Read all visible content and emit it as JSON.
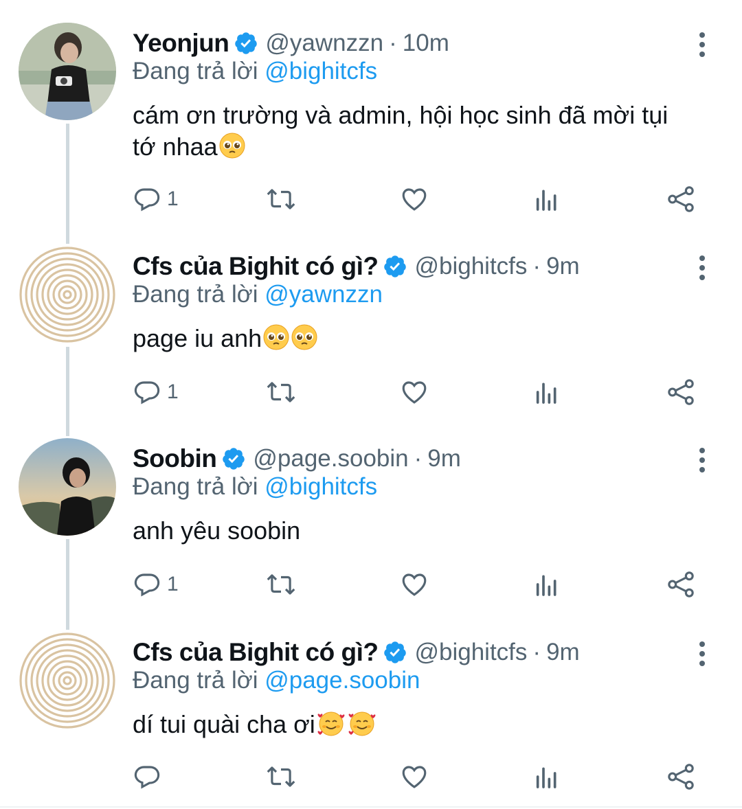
{
  "replying_prefix": "Đang trả lời",
  "colors": {
    "accent": "#1d9bf0",
    "muted": "#536471",
    "text": "#0f1419",
    "thread_line": "#cfd9de"
  },
  "tweets": [
    {
      "name": "Yeonjun",
      "handle": "@yawnzzn",
      "sep": "·",
      "time": "10m",
      "replying_to": "@bighitcfs",
      "text_lines": [
        "cám ơn trường và admin, hội học sinh đã mời tụi",
        "tớ nhaa"
      ],
      "emojis": [
        "pleading-face"
      ],
      "reply_count": "1",
      "avatar": "photo-person-with-camera"
    },
    {
      "name": "Cfs của Bighit có gì?",
      "handle": "@bighitcfs",
      "sep": "·",
      "time": "9m",
      "replying_to": "@yawnzzn",
      "text_lines": [
        "page iu anh"
      ],
      "emojis": [
        "pleading-face",
        "pleading-face"
      ],
      "reply_count": "1",
      "avatar": "spiral-logo"
    },
    {
      "name": "Soobin",
      "handle": "@page.soobin",
      "sep": "·",
      "time": "9m",
      "replying_to": "@bighitcfs",
      "text_lines": [
        "anh yêu soobin"
      ],
      "emojis": [],
      "reply_count": "1",
      "avatar": "photo-person-outdoors"
    },
    {
      "name": "Cfs của Bighit có gì?",
      "handle": "@bighitcfs",
      "sep": "·",
      "time": "9m",
      "replying_to": "@page.soobin",
      "text_lines": [
        "dí tui quài cha ơi"
      ],
      "emojis": [
        "smiling-face-with-hearts",
        "smiling-face-with-hearts"
      ],
      "reply_count": "",
      "avatar": "spiral-logo"
    }
  ],
  "icons": {
    "reply": "reply-bubble-icon",
    "retweet": "retweet-icon",
    "like": "heart-icon",
    "analytics": "analytics-bars-icon",
    "share": "share-icon",
    "more": "more-vertical-icon",
    "verified": "verified-badge-icon"
  }
}
